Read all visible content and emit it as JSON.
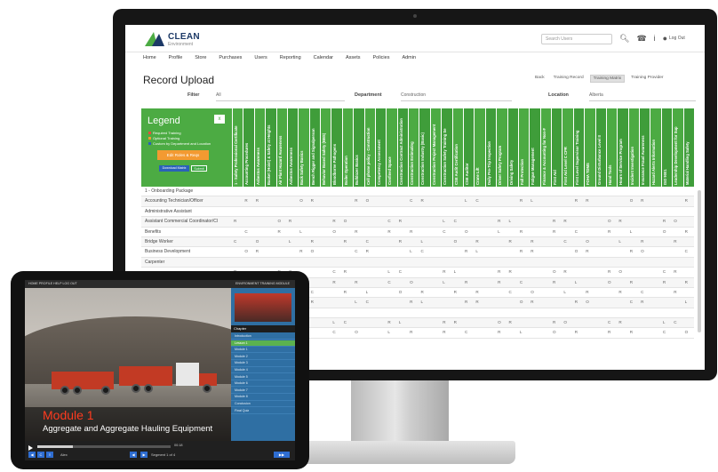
{
  "app": {
    "logo_main": "CLEAN",
    "logo_sub": "Environment",
    "search_placeholder": "Search Users",
    "login_label": "Log Out"
  },
  "nav": [
    "Home",
    "Profile",
    "Store",
    "Purchases",
    "Users",
    "Reporting",
    "Calendar",
    "Assets",
    "Policies",
    "Admin"
  ],
  "page_title": "Record Upload",
  "view_buttons": [
    "Back",
    "Training Record",
    "Training Matrix",
    "Training Provider"
  ],
  "filters": {
    "filter_label": "Filter",
    "filter_value": "All",
    "department_label": "Department",
    "department_value": "Construction",
    "location_label": "Location",
    "location_value": "Alberta"
  },
  "legend": {
    "title": "Legend",
    "close": "x",
    "items": [
      "Required Training",
      "Optional Training",
      "Custom by Department and Location"
    ],
    "edit_button": "Edit Roles & Reqs",
    "download_button": "Download Matrix",
    "submit_button": "Submit"
  },
  "columns": [
    "1 - Safety Professional Certificate",
    "Accounting Procedures",
    "Asbestos Awareness",
    "Basket (Hoist) & Safety at Heights",
    "Air Plant Hazard Awareness",
    "Asbestos Awareness",
    "Back Safety Basics",
    "Bench Rigger and Signalperson",
    "Behavior Based Safety (BBS)",
    "Bloodborne Pathogens",
    "Boiler Operation",
    "Bulldozer Basics",
    "Cell phone policy - Construction",
    "Competency Assessment",
    "Confined Space",
    "Construction Contract Administration",
    "Construction Estimating",
    "Construction Industry (Basic)",
    "Construction Project Management",
    "Construction Safety Training Se",
    "CSE Audit Certification",
    "CSE Auditor",
    "Crane Lift",
    "Daily Pre-Trip Inspection",
    "Driver Safety Program",
    "Driving Safety",
    "Fall Protection",
    "Fatigue Management",
    "Finance & Accounting for Non-F",
    "First Aid",
    "First Aid Level C CPR",
    "First Level Supervisor Training",
    "FOHA TDMS",
    "Ground Disturbance Level II",
    "Hand Tools",
    "Hours of Service Program",
    "Incident Investigation",
    "Insurance Fraud Awareness",
    "Hazard Alerts Information",
    "ISO 9001",
    "Leadership Development for Sup",
    "Material Handling Safety"
  ],
  "rows": [
    "1 - Onboarding Package",
    "Accounting Technician/Officer",
    "Administrative Assistant",
    "Assistant Commercial Coordinator/Cl",
    "Benefits",
    "Bridge Worker",
    "Business Development",
    "Carpenter",
    "",
    "",
    "",
    "",
    "",
    "",
    ""
  ],
  "tablet": {
    "top_links": "HOME  PROFILE  HELP  LOG OUT",
    "top_right": "ENVIRONMENT TRAINING MODULE",
    "module_title": "Module 1",
    "module_subtitle": "Aggregate and Aggregate Hauling Equipment",
    "time": "00:18",
    "chapters_label": "Chapter",
    "chapters": [
      "Introduction",
      "Lesson 1",
      "Module 1",
      "Module 2",
      "Module 3",
      "Module 4",
      "Module 5",
      "Module 6",
      "Module 7",
      "Module 8",
      "Conclusion",
      "Final Quiz"
    ],
    "active_chapter": 1,
    "bottom_right": "Segment 1 of 4",
    "user": "Alex"
  },
  "colors": {
    "brand_green": "#4cab43",
    "brand_blue": "#2e6dd1",
    "accent_orange": "#f39a31"
  }
}
